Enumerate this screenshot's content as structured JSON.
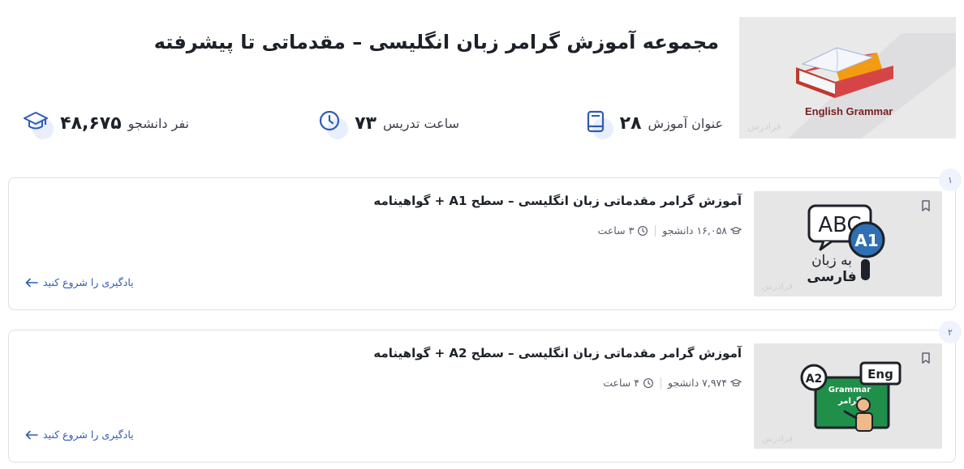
{
  "collection": {
    "title": "مجموعه آموزش گرامر زبان انگلیسی – مقدماتی تا پیشرفته",
    "image_caption": "English Grammar",
    "watermark": "فرادرس",
    "stats": {
      "courses_value": "۲۸",
      "courses_label": "عنوان آموزش",
      "courses_icon": "book-icon",
      "hours_value": "۷۳",
      "hours_label": "ساعت تدریس",
      "hours_icon": "clock-icon",
      "students_value": "۴۸,۶۷۵",
      "students_label": "نفر دانشجو",
      "students_icon": "graduation-cap-icon"
    }
  },
  "courses": [
    {
      "index": "۱",
      "title": "آموزش گرامر مقدماتی زبان انگلیسی – سطح A1 + گواهینامه",
      "students": "۱۶,۰۵۸ دانشجو",
      "duration": "۳ ساعت",
      "cta": "یادگیری را شروع کنید",
      "thumb": {
        "text1": "ABC",
        "badge": "A1",
        "text2": "به زبان",
        "text3": "فارسی",
        "watermark": "فرادرس"
      }
    },
    {
      "index": "۲",
      "title": "آموزش گرامر مقدماتی زبان انگلیسی – سطح A2 + گواهینامه",
      "students": "۷,۹۷۴ دانشجو",
      "duration": "۴ ساعت",
      "cta": "یادگیری را شروع کنید",
      "thumb": {
        "badge": "A2",
        "eng": "Eng",
        "board1": "Grammar",
        "board2": "گرامر",
        "watermark": "فرادرس"
      }
    }
  ],
  "colors": {
    "accent": "#2f5bb7",
    "icon_bg": "#e8eefb",
    "border": "#dcdfe4"
  }
}
